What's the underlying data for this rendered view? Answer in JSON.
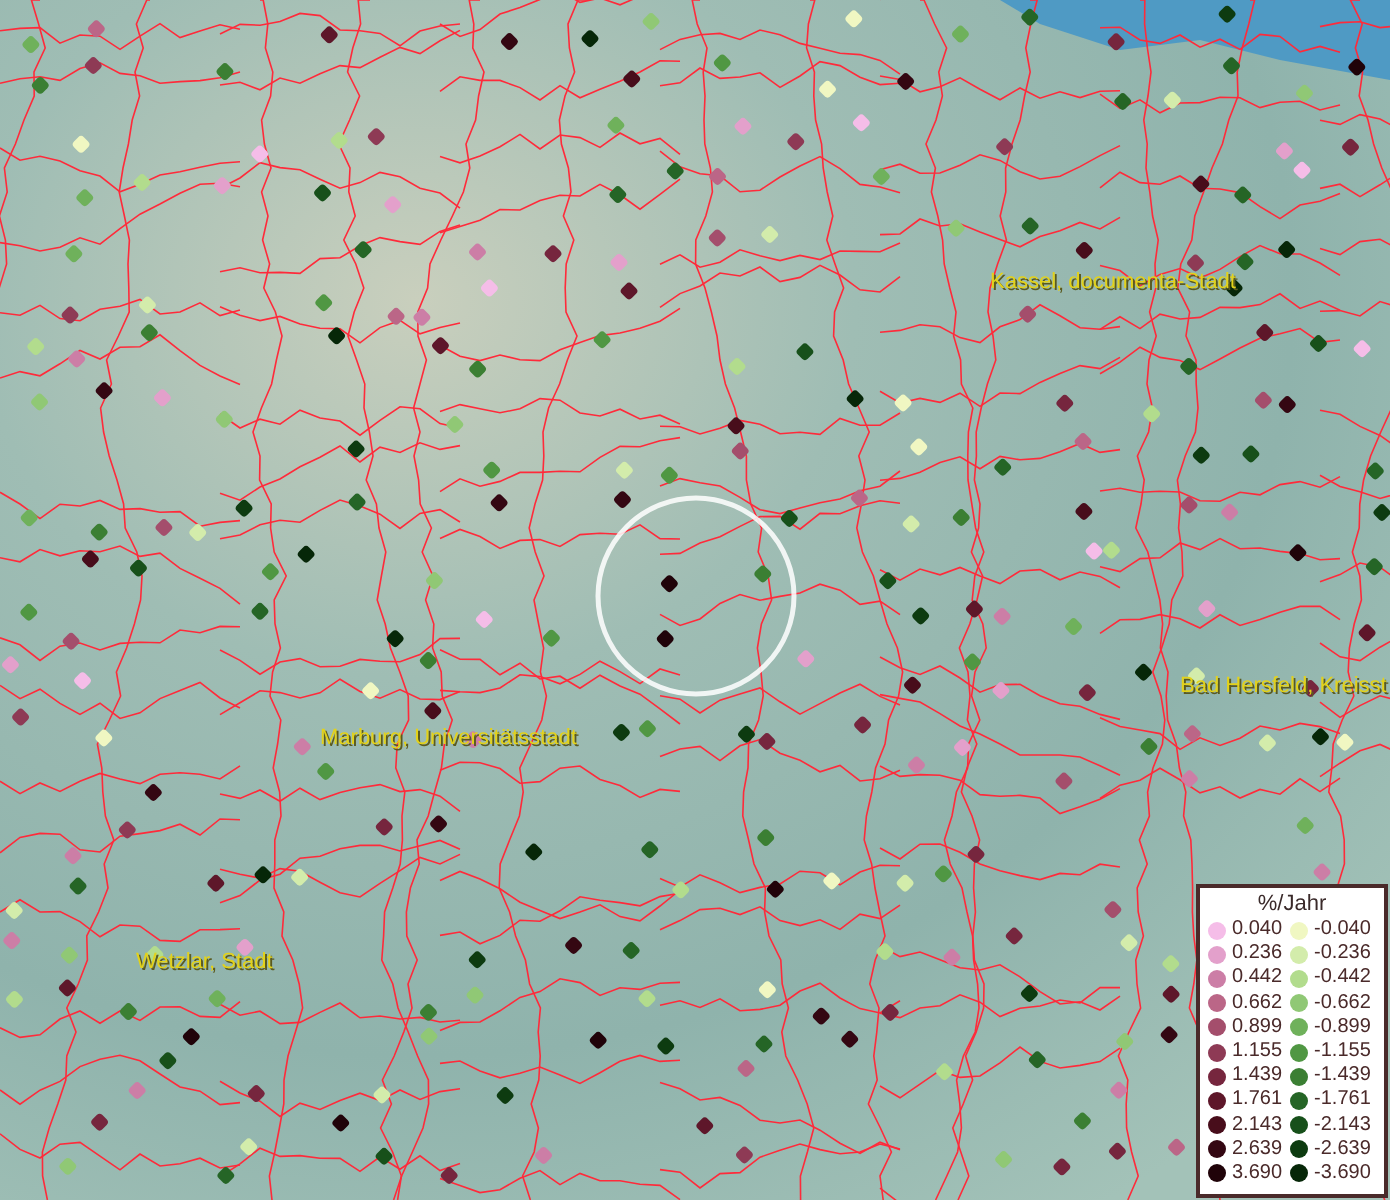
{
  "place_labels": [
    {
      "text": "Kassel, documenta-Stadt"
    },
    {
      "text": "Bad Hersfeld, Kreisst"
    },
    {
      "text": "Marburg, Universitätsstadt"
    },
    {
      "text": "Wetzlar, Stadt"
    }
  ],
  "legend": {
    "title": "%/Jahr",
    "columns": [
      [
        {
          "label": "0.040",
          "color": "#f5bde8"
        },
        {
          "label": "0.236",
          "color": "#e3a0cb"
        },
        {
          "label": "0.442",
          "color": "#cc7ea6"
        },
        {
          "label": "0.662",
          "color": "#bb6687"
        },
        {
          "label": "0.899",
          "color": "#a44e6c"
        },
        {
          "label": "1.155",
          "color": "#8e3a55"
        },
        {
          "label": "1.439",
          "color": "#76263e"
        },
        {
          "label": "1.761",
          "color": "#5e172a"
        },
        {
          "label": "2.143",
          "color": "#480d1b"
        },
        {
          "label": "2.639",
          "color": "#340712"
        },
        {
          "label": "3.690",
          "color": "#200309"
        }
      ],
      [
        {
          "label": "-0.040",
          "color": "#f0f7c2"
        },
        {
          "label": "-0.236",
          "color": "#d3ecab"
        },
        {
          "label": "-0.442",
          "color": "#b2dc8d"
        },
        {
          "label": "-0.662",
          "color": "#90c875"
        },
        {
          "label": "-0.899",
          "color": "#6fb15b"
        },
        {
          "label": "-1.155",
          "color": "#509743"
        },
        {
          "label": "-1.439",
          "color": "#3b7f33"
        },
        {
          "label": "-1.761",
          "color": "#256526"
        },
        {
          "label": "-2.143",
          "color": "#17501a"
        },
        {
          "label": "-2.639",
          "color": "#0d3b10"
        },
        {
          "label": "-3.690",
          "color": "#062708"
        }
      ]
    ]
  }
}
